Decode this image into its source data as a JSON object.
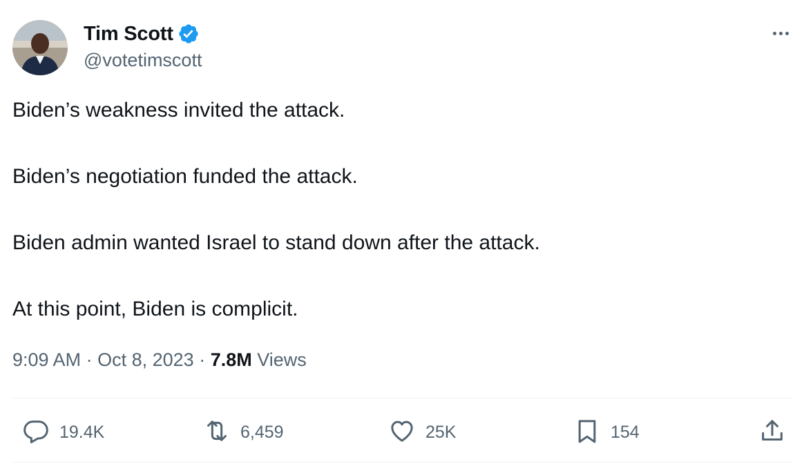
{
  "author": {
    "name": "Tim Scott",
    "handle": "@votetimscott",
    "verified": true,
    "verified_color": "#1d9bf0"
  },
  "tweet": {
    "paragraphs": [
      "Biden’s weakness invited the attack.",
      "Biden’s negotiation funded the attack.",
      "Biden admin wanted Israel to stand down after the attack.",
      "At this point, Biden is complicit."
    ]
  },
  "meta": {
    "time": "9:09 AM",
    "date": "Oct 8, 2023",
    "separator": "·",
    "views_count": "7.8M",
    "views_label": "Views"
  },
  "actions": {
    "replies": "19.4K",
    "retweets": "6,459",
    "likes": "25K",
    "bookmarks": "154"
  },
  "icons": {
    "reply": "reply-icon",
    "retweet": "retweet-icon",
    "like": "heart-icon",
    "bookmark": "bookmark-icon",
    "share": "share-icon",
    "more": "more-icon",
    "verified": "verified-badge-icon"
  },
  "colors": {
    "text": "#0f1419",
    "secondary": "#536471",
    "divider": "#eff3f4"
  }
}
